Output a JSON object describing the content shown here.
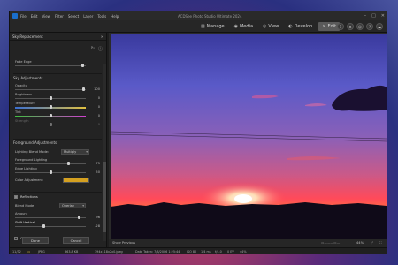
{
  "titlebar": {
    "menu": [
      "File",
      "Edit",
      "View",
      "Filter",
      "Select",
      "Layer",
      "Tools",
      "Help"
    ],
    "title": "ACDSee Photo Studio Ultimate 2024"
  },
  "modes": [
    {
      "label": "Manage",
      "icon": "manage-icon",
      "active": false
    },
    {
      "label": "Media",
      "icon": "media-icon",
      "active": false
    },
    {
      "label": "View",
      "icon": "view-icon",
      "active": false
    },
    {
      "label": "Develop",
      "icon": "develop-icon",
      "active": false
    },
    {
      "label": "Edit",
      "icon": "edit-icon",
      "active": true
    }
  ],
  "panel": {
    "title": "Sky Replacement",
    "fade_edge": {
      "label": "Fade Edge",
      "value": 0.95
    },
    "sky_section": "Sky Adjustments",
    "sky_sliders": [
      {
        "label": "Opacity",
        "value": "100",
        "level": 0.97
      },
      {
        "label": "Brightness",
        "value": "0",
        "level": 0.5
      },
      {
        "label": "Temperature",
        "value": "0",
        "level": 0.5
      },
      {
        "label": "Tint",
        "value": "0",
        "level": 0.5
      },
      {
        "label": "Strength",
        "value": "0",
        "level": 0.5
      }
    ],
    "fg_section": "Foreground Adjustments",
    "lighting_blend_label": "Lighting Blend Mode:",
    "lighting_blend_value": "Multiply",
    "fg_sliders": [
      {
        "label": "Foreground Lighting",
        "value": "75",
        "level": 0.75
      },
      {
        "label": "Edge Lighting",
        "value": "50",
        "level": 0.5
      }
    ],
    "color_adjustment_label": "Color Adjustment:",
    "color_adjustment_swatch": "#d4a020",
    "reflections_label": "Reflections",
    "blend_mode_label": "Blend Mode:",
    "blend_mode_value": "Overlay",
    "refl_sliders": [
      {
        "label": "Amount",
        "value": "96",
        "level": 0.9
      },
      {
        "label": "Shift Vertical",
        "value": "-28",
        "level": 0.4
      }
    ],
    "output_layers_label": "Output as Layers",
    "done_label": "Done",
    "cancel_label": "Cancel"
  },
  "viewer": {
    "show_previous_label": "Show Previous",
    "zoom_label": "44%"
  },
  "statusbar": {
    "page": "11/32",
    "format": "JPEG",
    "file_size": "363.8 KB",
    "filename": "394x118x2x0.jpeg",
    "date": "Date Taken: 7/8/2006 1:25:44",
    "iso": "ISO 80",
    "exposure": "1/4 ms",
    "fstop": "f/4.0",
    "ev": "0 EV",
    "zoom": "44%"
  }
}
